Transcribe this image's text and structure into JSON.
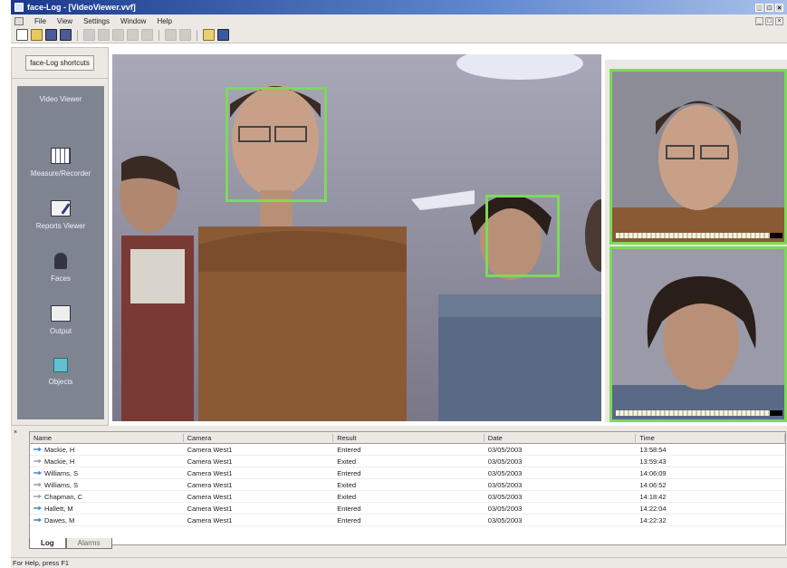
{
  "window": {
    "title": "face-Log - [VideoViewer.vvf]"
  },
  "menu": {
    "items": [
      "File",
      "View",
      "Settings",
      "Window",
      "Help"
    ]
  },
  "toolbar": {
    "icons": [
      "new-document-icon",
      "open-folder-icon",
      "save-icon",
      "save-all-icon",
      "cut-icon",
      "copy-icon",
      "paste-icon",
      "undo-icon",
      "redo-icon",
      "print-icon",
      "print-preview-icon",
      "help-icon",
      "whats-this-icon"
    ]
  },
  "sidebar": {
    "title": "face-Log shortcuts",
    "items": [
      {
        "label": "Video Viewer",
        "icon": "video-viewer-icon"
      },
      {
        "label": "Measure/Recorder",
        "icon": "measure-recorder-icon"
      },
      {
        "label": "Reports Viewer",
        "icon": "reports-viewer-icon"
      },
      {
        "label": "Faces",
        "icon": "faces-icon"
      },
      {
        "label": "Output",
        "icon": "output-icon"
      },
      {
        "label": "Objects",
        "icon": "objects-icon"
      }
    ]
  },
  "log": {
    "columns": [
      "Name",
      "Camera",
      "Result",
      "Date",
      "Time"
    ],
    "rows": [
      {
        "name": "Mackie, H",
        "camera": "Camera West1",
        "result": "Entered",
        "date": "03/05/2003",
        "time": "13:58:54",
        "direction": "in"
      },
      {
        "name": "Mackie, H",
        "camera": "Camera West1",
        "result": "Exited",
        "date": "03/05/2003",
        "time": "13:59:43",
        "direction": "out"
      },
      {
        "name": "Williams, S",
        "camera": "Camera West1",
        "result": "Entered",
        "date": "03/05/2003",
        "time": "14:06:09",
        "direction": "in"
      },
      {
        "name": "Williams, S",
        "camera": "Camera West1",
        "result": "Exited",
        "date": "03/05/2003",
        "time": "14:06:52",
        "direction": "out"
      },
      {
        "name": "Chapman, C",
        "camera": "Camera West1",
        "result": "Exited",
        "date": "03/05/2003",
        "time": "14:18:42",
        "direction": "out"
      },
      {
        "name": "Hallett, M",
        "camera": "Camera West1",
        "result": "Entered",
        "date": "03/05/2003",
        "time": "14:22:04",
        "direction": "in"
      },
      {
        "name": "Dawes, M",
        "camera": "Camera West1",
        "result": "Entered",
        "date": "03/05/2003",
        "time": "14:22:32",
        "direction": "in"
      }
    ],
    "tabs": [
      "Log",
      "Alarms"
    ]
  },
  "status": {
    "text": "For Help, press F1"
  },
  "colors": {
    "detection_box": "#7fd85a",
    "sidebar_bg": "#7f8590",
    "titlebar": "#1a3a8c"
  }
}
